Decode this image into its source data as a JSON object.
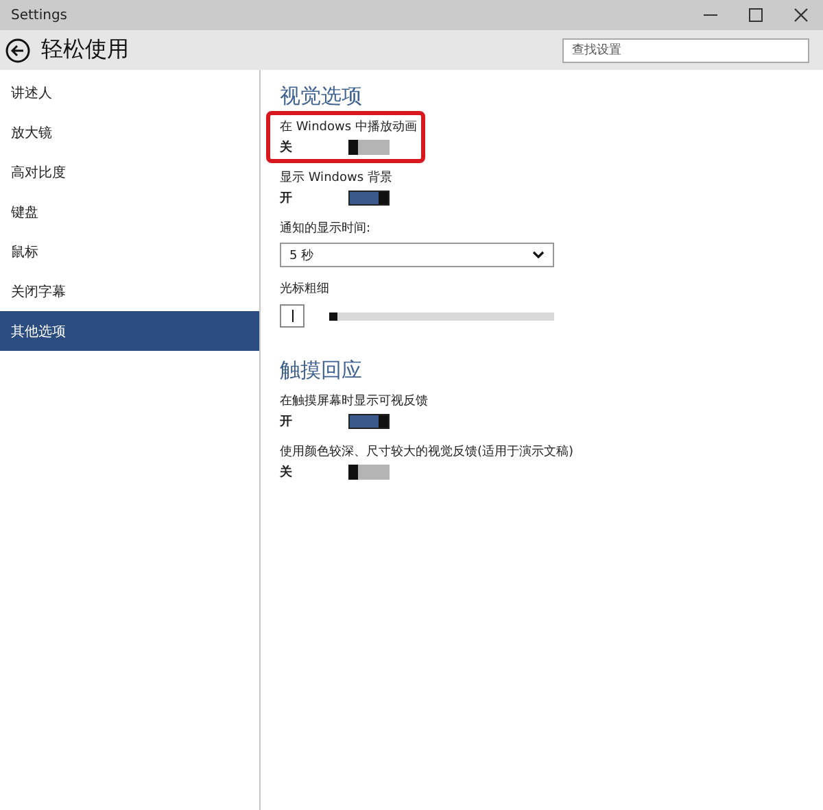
{
  "window": {
    "title": "Settings"
  },
  "header": {
    "title": "轻松使用",
    "search": {
      "placeholder": "查找设置"
    }
  },
  "sidebar": {
    "items": [
      {
        "label": "讲述人",
        "selected": false
      },
      {
        "label": "放大镜",
        "selected": false
      },
      {
        "label": "高对比度",
        "selected": false
      },
      {
        "label": "键盘",
        "selected": false
      },
      {
        "label": "鼠标",
        "selected": false
      },
      {
        "label": "关闭字幕",
        "selected": false
      },
      {
        "label": "其他选项",
        "selected": true
      }
    ]
  },
  "content": {
    "sections": [
      {
        "heading": "视觉选项",
        "settings": [
          {
            "kind": "toggle",
            "label": "在 Windows 中播放动画",
            "state_text": "关",
            "on": false,
            "highlighted": true
          },
          {
            "kind": "toggle",
            "label": "显示 Windows 背景",
            "state_text": "开",
            "on": true,
            "highlighted": false
          },
          {
            "kind": "dropdown",
            "label": "通知的显示时间:",
            "value": "5 秒"
          },
          {
            "kind": "slider",
            "label": "光标粗细",
            "level": 0.0
          }
        ]
      },
      {
        "heading": "触摸回应",
        "settings": [
          {
            "kind": "toggle",
            "label": "在触摸屏幕时显示可视反馈",
            "state_text": "开",
            "on": true,
            "highlighted": false
          },
          {
            "kind": "toggle",
            "label": "使用颜色较深、尺寸较大的视觉反馈(适用于演示文稿)",
            "state_text": "关",
            "on": false,
            "highlighted": false
          }
        ]
      }
    ]
  }
}
